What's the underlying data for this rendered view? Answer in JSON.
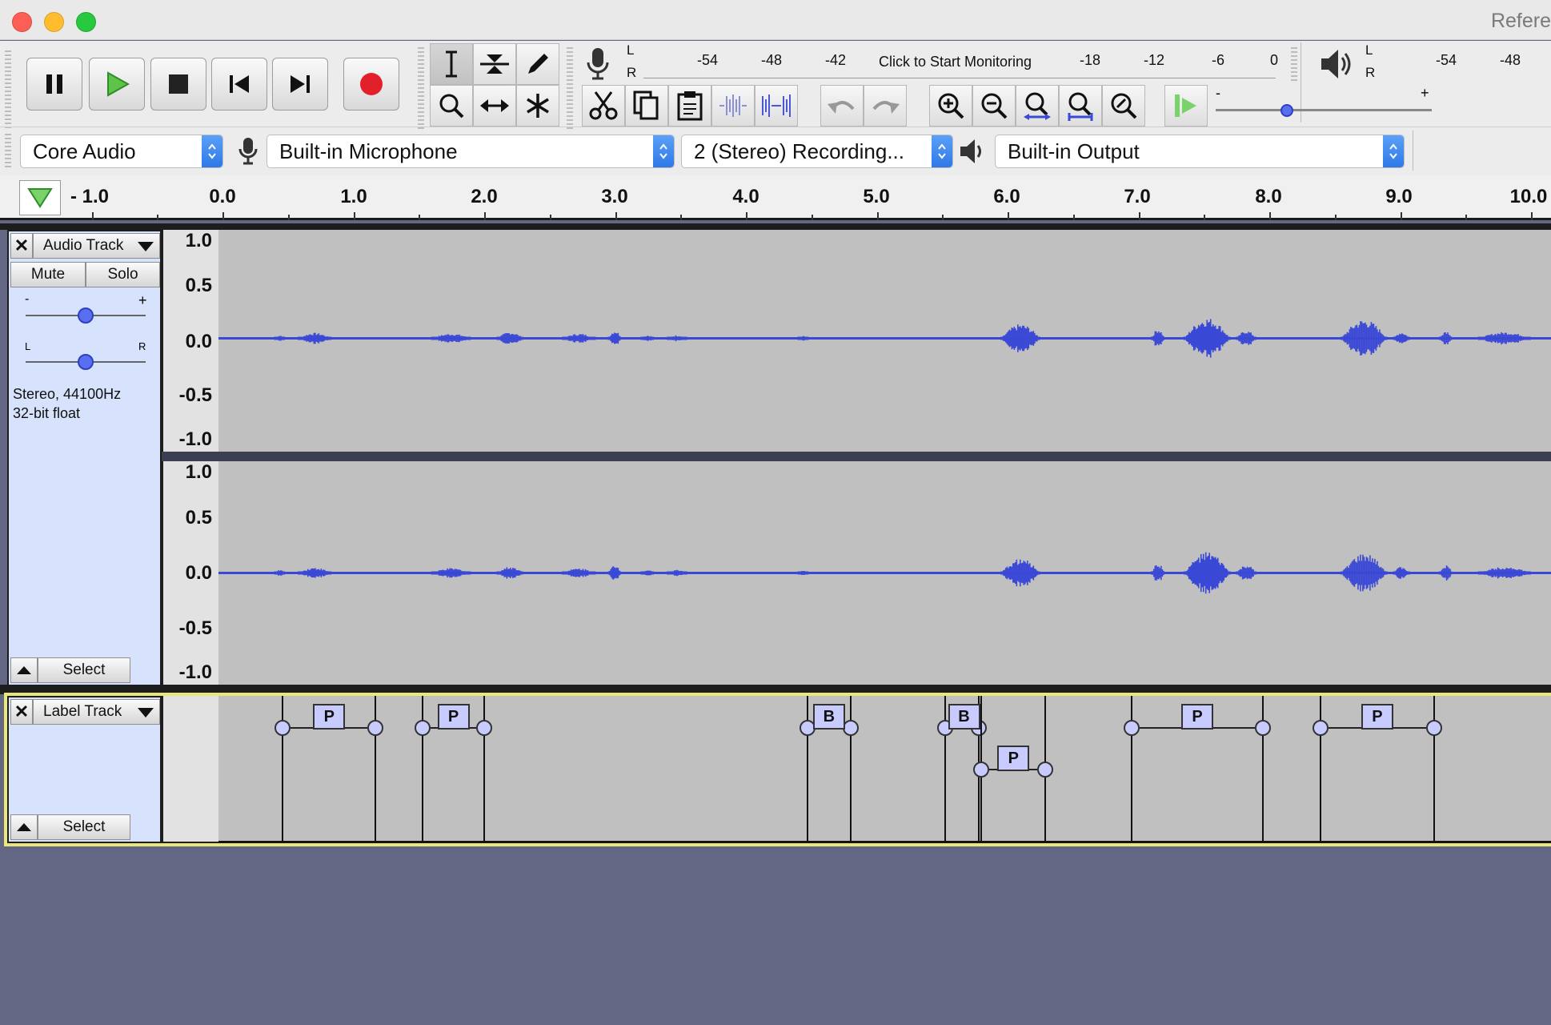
{
  "window": {
    "title": "Refere"
  },
  "transport": {
    "pause": "pause-icon",
    "play": "play-icon",
    "stop": "stop-icon",
    "skip_start": "skip-to-start-icon",
    "skip_end": "skip-to-end-icon",
    "record": "record-icon"
  },
  "recording_meter": {
    "channel_l": "L",
    "channel_r": "R",
    "scale": [
      "-54",
      "-48",
      "-42",
      "-18",
      "-12",
      "-6",
      "0"
    ],
    "monitor_text": "Click to Start Monitoring"
  },
  "playback_meter": {
    "channel_l": "L",
    "channel_r": "R",
    "scale": [
      "-54",
      "-48"
    ]
  },
  "playback_speed": {
    "min_label": "-",
    "max_label": "+",
    "level": 0.33
  },
  "devices": {
    "host": "Core Audio",
    "input": "Built-in Microphone",
    "channels": "2 (Stereo) Recording...",
    "output": "Built-in Output"
  },
  "ruler": {
    "labels": [
      "- 1.0",
      "0.0",
      "1.0",
      "2.0",
      "3.0",
      "4.0",
      "5.0",
      "6.0",
      "7.0",
      "8.0",
      "9.0",
      "10.0"
    ]
  },
  "audio_track": {
    "name": "Audio Track",
    "mute": "Mute",
    "solo": "Solo",
    "gain_minus": "-",
    "gain_plus": "+",
    "pan_l": "L",
    "pan_r": "R",
    "gain_level": 0.5,
    "pan_level": 0.5,
    "format_line1": "Stereo, 44100Hz",
    "format_line2": "32-bit float",
    "select": "Select",
    "scale": [
      "1.0",
      "0.5",
      "0.0",
      "-0.5",
      "-1.0"
    ],
    "wave_color": "#3a48d6"
  },
  "label_track": {
    "name": "Label Track",
    "select": "Select",
    "labels": [
      {
        "text": "P",
        "start": 0.46,
        "end": 1.17
      },
      {
        "text": "P",
        "start": 1.53,
        "end": 2.0
      },
      {
        "text": "B",
        "start": 4.47,
        "end": 4.8
      },
      {
        "text": "B",
        "start": 5.52,
        "end": 5.78
      },
      {
        "text": "P",
        "start": 5.8,
        "end": 6.29
      },
      {
        "text": "P",
        "start": 6.95,
        "end": 7.95
      },
      {
        "text": "P",
        "start": 8.39,
        "end": 9.26
      }
    ]
  }
}
